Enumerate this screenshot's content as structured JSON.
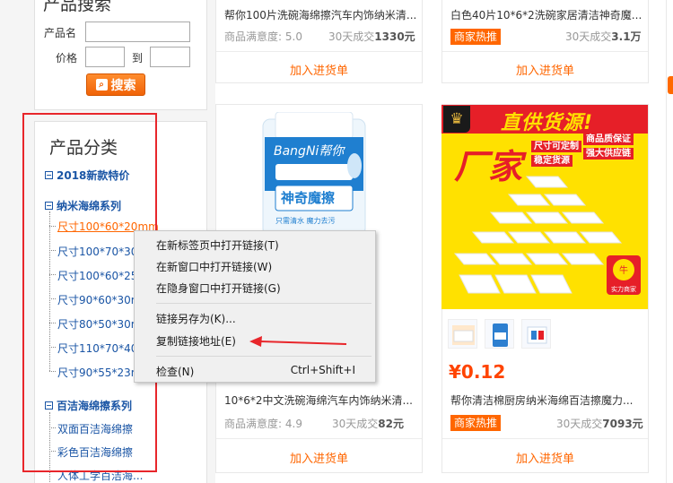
{
  "search": {
    "title": "产品搜索",
    "name_label": "产品名",
    "price_label": "价格",
    "to_label": "到",
    "button_label": "搜索",
    "name_value": "",
    "price_min": "",
    "price_max": ""
  },
  "categories": {
    "title": "产品分类",
    "group1": "2018新款特价",
    "group2": "纳米海绵系列",
    "group2_items": [
      "尺寸100*60*20mm",
      "尺寸100*70*30",
      "尺寸100*60*25",
      "尺寸90*60*30m",
      "尺寸80*50*30m",
      "尺寸110*70*40",
      "尺寸90*55*23m"
    ],
    "group3": "百洁海绵擦系列",
    "group3_items": [
      "双面百洁海绵擦",
      "彩色百洁海绵擦",
      "人体工学百洁海..."
    ]
  },
  "products": [
    {
      "title": "帮你100片洗碗海绵擦汽车内饰纳米清...",
      "satisfaction_label": "商品满意度:",
      "satisfaction": "5.0",
      "deal_label": "30天成交",
      "deal": "1330元",
      "cart": "加入进货单"
    },
    {
      "title": "白色40片10*6*2洗碗家居清洁神奇魔...",
      "badge": "商家热推",
      "deal_label": "30天成交",
      "deal": "3.1万",
      "cart": "加入进货单"
    },
    {
      "title": "10*6*2中文洗碗海绵汽车内饰纳米清...",
      "satisfaction_label": "商品满意度:",
      "satisfaction": "4.9",
      "deal_label": "30天成交",
      "deal": "82元",
      "cart": "加入进货单"
    },
    {
      "price": "¥0.12",
      "title": "帮你清洁棉厨房纳米海绵百洁擦魔力...",
      "badge": "商家热推",
      "deal_label": "30天成交",
      "deal": "7093元",
      "cart": "加入进货单"
    }
  ],
  "packet": {
    "brand": "BangNi帮你",
    "name": "神奇魔擦",
    "slogan": "只需清水 魔力去污"
  },
  "ad": {
    "slogan": "直供货源!",
    "big": "厂家",
    "tag1": "尺寸可定制",
    "tag2": "稳定货源",
    "tag3": "商品质保证",
    "tag4": "强大供应链",
    "seal": "实力商家"
  },
  "context_menu": {
    "items": [
      "在新标签页中打开链接(T)",
      "在新窗口中打开链接(W)",
      "在隐身窗口中打开链接(G)",
      "链接另存为(K)...",
      "复制链接地址(E)",
      "检查(N)"
    ],
    "inspect_shortcut": "Ctrl+Shift+I"
  },
  "colors": {
    "accent": "#ff6600",
    "link": "#1a55a5",
    "highlight_frame": "#e8262b",
    "ad_yellow": "#ffe100",
    "ad_red": "#e61f28"
  }
}
